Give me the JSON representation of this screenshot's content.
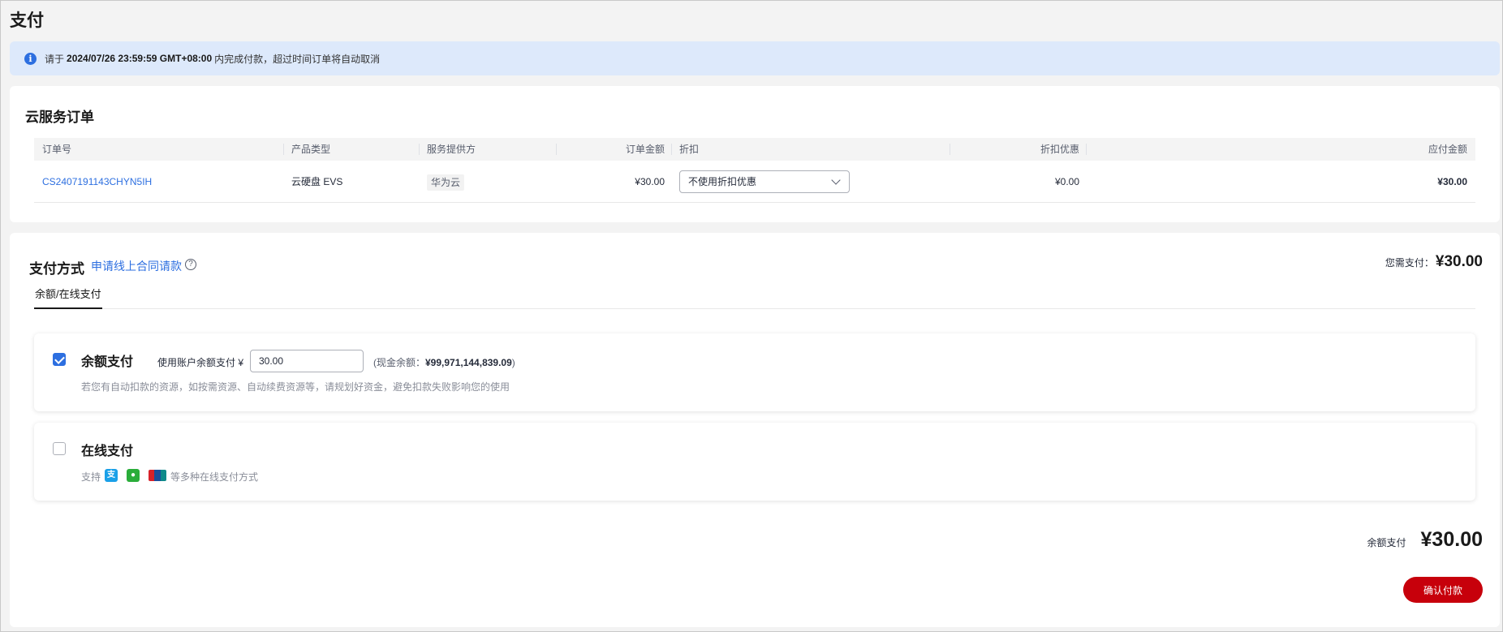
{
  "page": {
    "title": "支付"
  },
  "notice": {
    "prefix": "请于",
    "deadline": "2024/07/26 23:59:59 GMT+08:00",
    "suffix": "内完成付款，超过时间订单将自动取消"
  },
  "order": {
    "title": "云服务订单",
    "columns": [
      "订单号",
      "产品类型",
      "服务提供方",
      "订单金额",
      "折扣",
      "折扣优惠",
      "应付金额"
    ],
    "row": {
      "order_no": "CS2407191143CHYN5IH",
      "product_type": "云硬盘 EVS",
      "provider": "华为云",
      "amount": "¥30.00",
      "discount_selected": "不使用折扣优惠",
      "discount_value": "¥0.00",
      "payable": "¥30.00"
    }
  },
  "payment": {
    "title": "支付方式",
    "apply_link": "申请线上合同请款",
    "need_pay_label": "您需支付：",
    "need_pay_amount": "¥30.00",
    "tabs": [
      "余额/在线支付"
    ],
    "balance": {
      "title": "余额支付",
      "checked": true,
      "use_label": "使用账户余额支付 ¥",
      "input_value": "30.00",
      "cash_open": "(现金余额：",
      "cash_value": "¥99,971,144,839.09",
      "cash_close": ")",
      "note": "若您有自动扣款的资源，如按需资源、自动续费资源等，请规划好资金，避免扣款失败影响您的使用"
    },
    "online": {
      "title": "在线支付",
      "checked": false,
      "support_label": "支持",
      "support_suffix": "等多种在线支付方式",
      "icons": [
        "alipay-icon",
        "wechat-pay-icon",
        "unionpay-icon"
      ]
    },
    "total_label": "余额支付",
    "total_amount": "¥30.00",
    "confirm_label": "确认付款"
  },
  "colors": {
    "accent": "#2d6fe0",
    "brand_red": "#c7000b",
    "notice_bg": "#dde9fb"
  }
}
